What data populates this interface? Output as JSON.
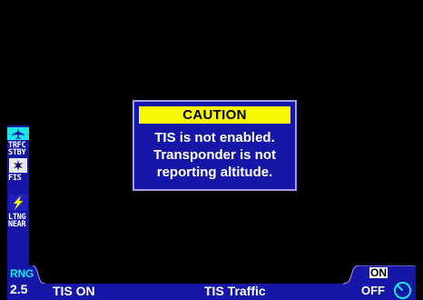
{
  "sidebar": {
    "items": [
      {
        "icon": "airplane-icon",
        "label_line1": "TRFC",
        "label_line2": "STBY"
      },
      {
        "icon": "weather-data-icon",
        "label_line1": "FIS",
        "label_line2": ""
      },
      {
        "icon": "lightning-icon",
        "label_line1": "LTNG",
        "label_line2": "NEAR"
      }
    ]
  },
  "caution": {
    "header": "CAUTION",
    "lines": [
      "TIS is not enabled.",
      "Transponder is not",
      "reporting altitude."
    ]
  },
  "status_bar": {
    "range_label": "RNG",
    "range_value": "2.5",
    "tis_status": "TIS ON",
    "mode_title": "TIS Traffic",
    "on_label": "ON",
    "off_label": "OFF"
  },
  "colors": {
    "background": "#000000",
    "panel_blue": "#1616a8",
    "caution_yellow": "#f8f800",
    "accent_cyan": "#18e8e8",
    "icon_yellow": "#f8f800"
  }
}
